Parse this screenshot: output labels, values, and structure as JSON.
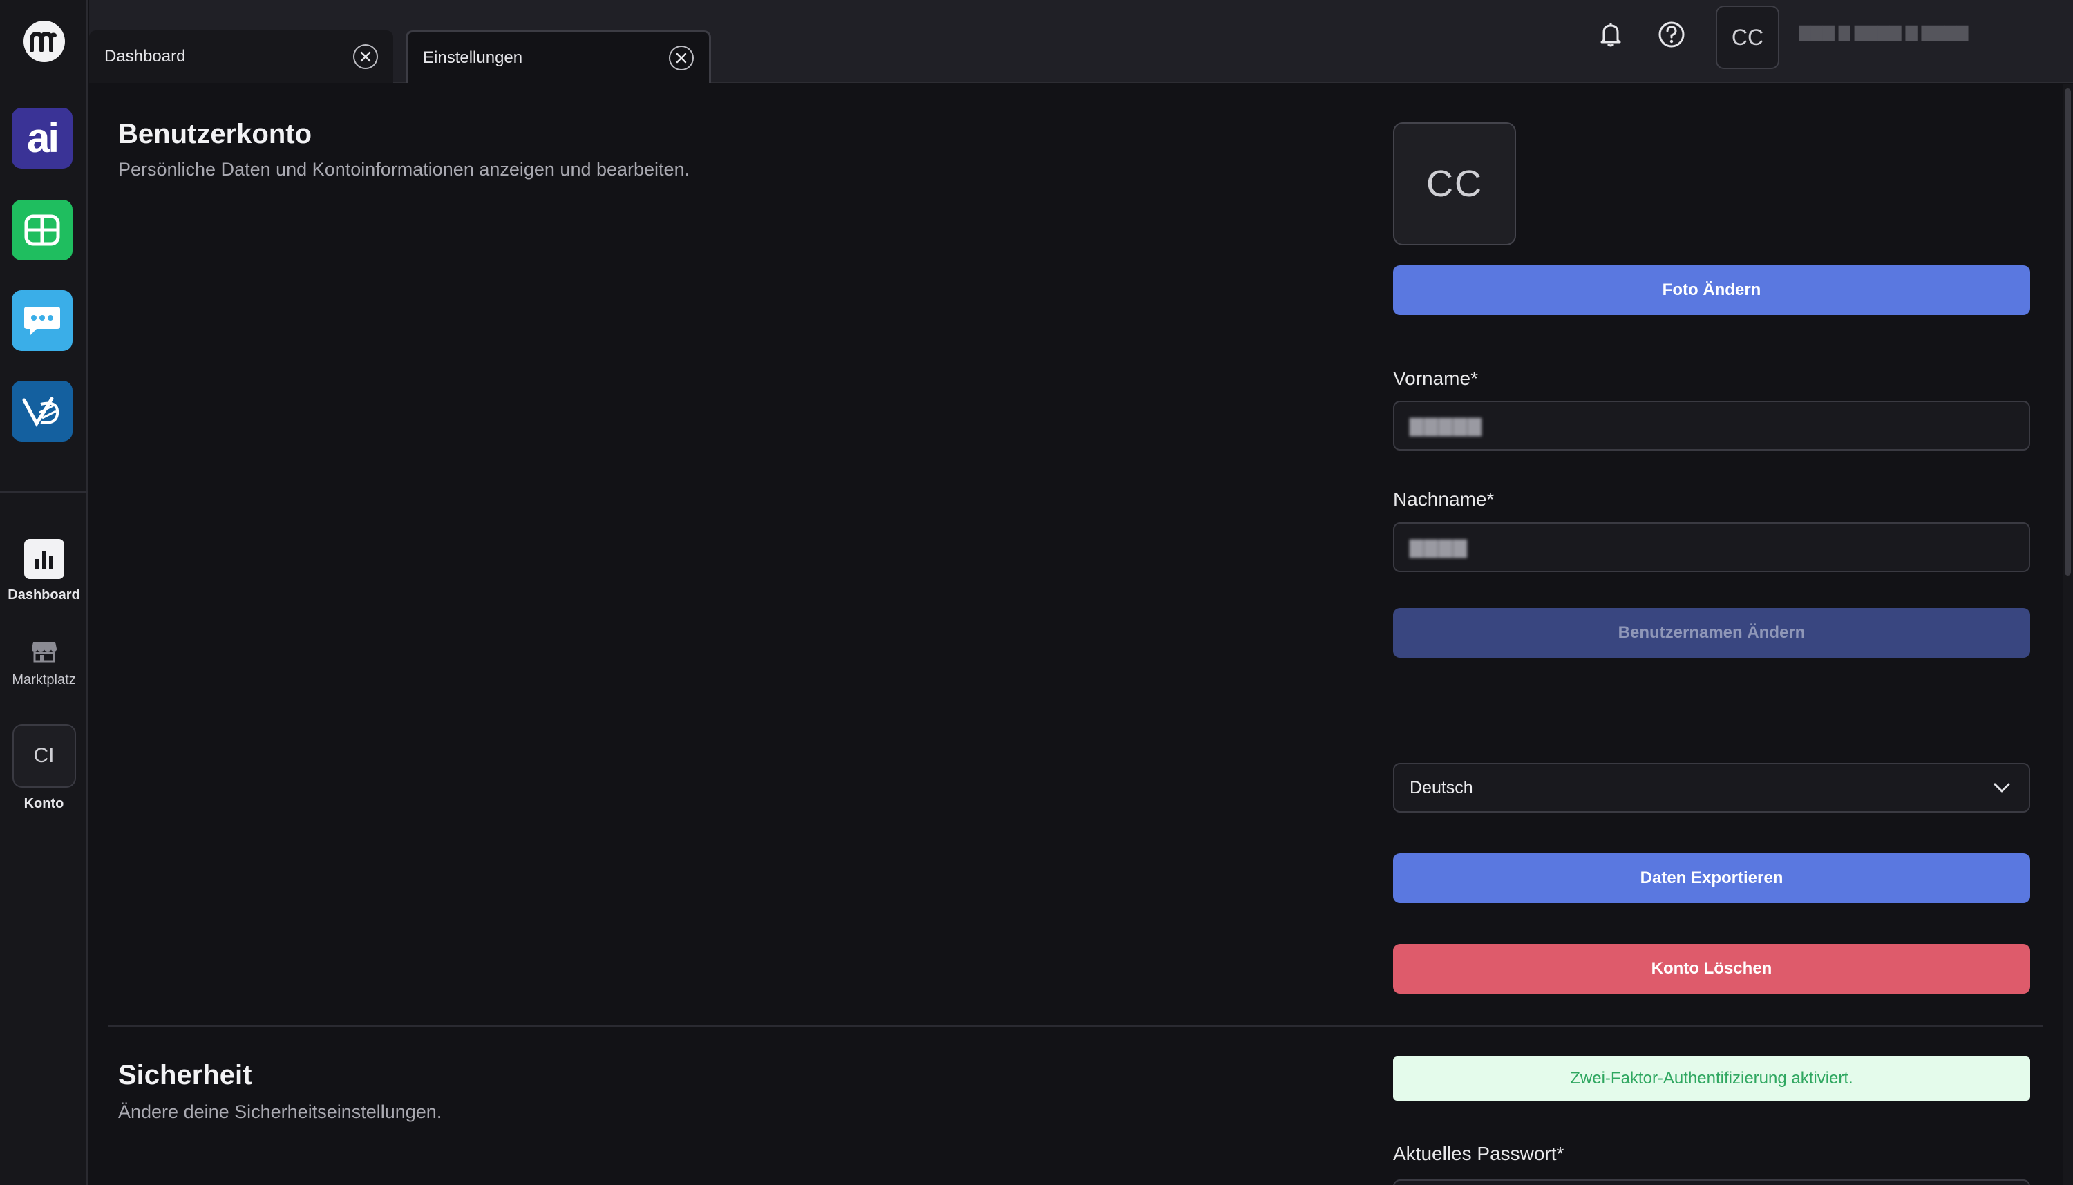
{
  "tabs": [
    {
      "label": "Dashboard"
    },
    {
      "label": "Einstellungen"
    }
  ],
  "header": {
    "avatar_initials": "CC",
    "user_name": "▇▇▇  ▇  ▇▇▇▇  ▇  ▇▇▇▇"
  },
  "sidebar": {
    "apps": [
      {
        "name": "ai",
        "color": "#3a3396"
      },
      {
        "name": "grid-app",
        "color": "#1fbe5f"
      },
      {
        "name": "chat-app",
        "color": "#3aaee8"
      },
      {
        "name": "v-app",
        "color": "#14609f"
      }
    ],
    "nav": [
      {
        "label": "Dashboard"
      },
      {
        "label": "Marktplatz"
      },
      {
        "label": "Konto",
        "initials": "CI"
      }
    ]
  },
  "account": {
    "title": "Benutzerkonto",
    "description": "Persönliche Daten und Kontoinformationen anzeigen und bearbeiten.",
    "avatar_initials": "CC",
    "change_photo_label": "Foto Ändern",
    "first_name_label": "Vorname*",
    "first_name_value": "▇▇▇▇▇",
    "last_name_label": "Nachname*",
    "last_name_value": "▇▇▇▇",
    "change_username_label": "Benutzernamen Ändern",
    "language_value": "Deutsch",
    "export_label": "Daten Exportieren",
    "delete_label": "Konto Löschen"
  },
  "security": {
    "title": "Sicherheit",
    "description": "Ändere deine Sicherheitseinstellungen.",
    "twofa_status": "Zwei-Faktor-Authentifizierung aktiviert.",
    "current_password_label": "Aktuelles Passwort*"
  },
  "colors": {
    "primary": "#5a78e0",
    "danger": "#de5b6b",
    "success_bg": "#e4fbeb",
    "success_text": "#2fa760"
  }
}
